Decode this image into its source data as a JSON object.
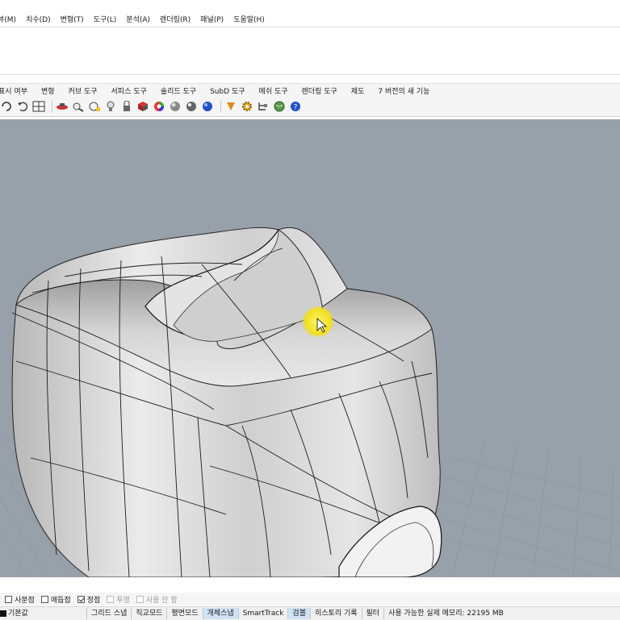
{
  "menu": {
    "items": [
      "뷰(M)",
      "치수(D)",
      "변형(T)",
      "도구(L)",
      "분석(A)",
      "렌더링(R)",
      "패널(P)",
      "도움말(H)"
    ]
  },
  "tabs": [
    "표시 여부",
    "변형",
    "커브 도구",
    "서피스 도구",
    "솔리드 도구",
    "SubD 도구",
    "메쉬 도구",
    "렌더링 도구",
    "제도",
    "7 버전의 새 기능"
  ],
  "toolbar": {
    "icons": [
      "rotate-view-icon",
      "undo-view-icon",
      "four-viewports-icon",
      "named-views-icon",
      "zoom-extents-icon",
      "zoom-selected-icon",
      "light-bulb-icon",
      "lock-icon",
      "materials-icon",
      "color-wheel-icon",
      "shaded-sphere-icon",
      "rendered-sphere-icon",
      "blue-sphere-icon",
      "pin-icon",
      "gear-icon",
      "tree-icon",
      "globe-icon",
      "help-icon"
    ]
  },
  "osnap": {
    "items": [
      {
        "label": "사분점",
        "checked": false,
        "disabled": false
      },
      {
        "label": "매듭점",
        "checked": false,
        "disabled": false
      },
      {
        "label": "정점",
        "checked": true,
        "disabled": false
      },
      {
        "label": "투영",
        "checked": false,
        "disabled": true
      },
      {
        "label": "사용 안 함",
        "checked": false,
        "disabled": true
      }
    ]
  },
  "status": {
    "layer": "기본값",
    "grid_snap": "그리드 스냅",
    "ortho": "직교모드",
    "planar": "평면모드",
    "osnap": "개체스냅",
    "smarttrack": "SmartTrack",
    "gumball": "검볼",
    "history": "히스토리 기록",
    "filter": "필터",
    "memory": "사용 가능한 실제 메모리: 22195 MB"
  },
  "colors": {
    "viewport_bg": "#98a0a9",
    "surface": "#d4d4d4",
    "cursor_highlight": "#f3e52a"
  }
}
